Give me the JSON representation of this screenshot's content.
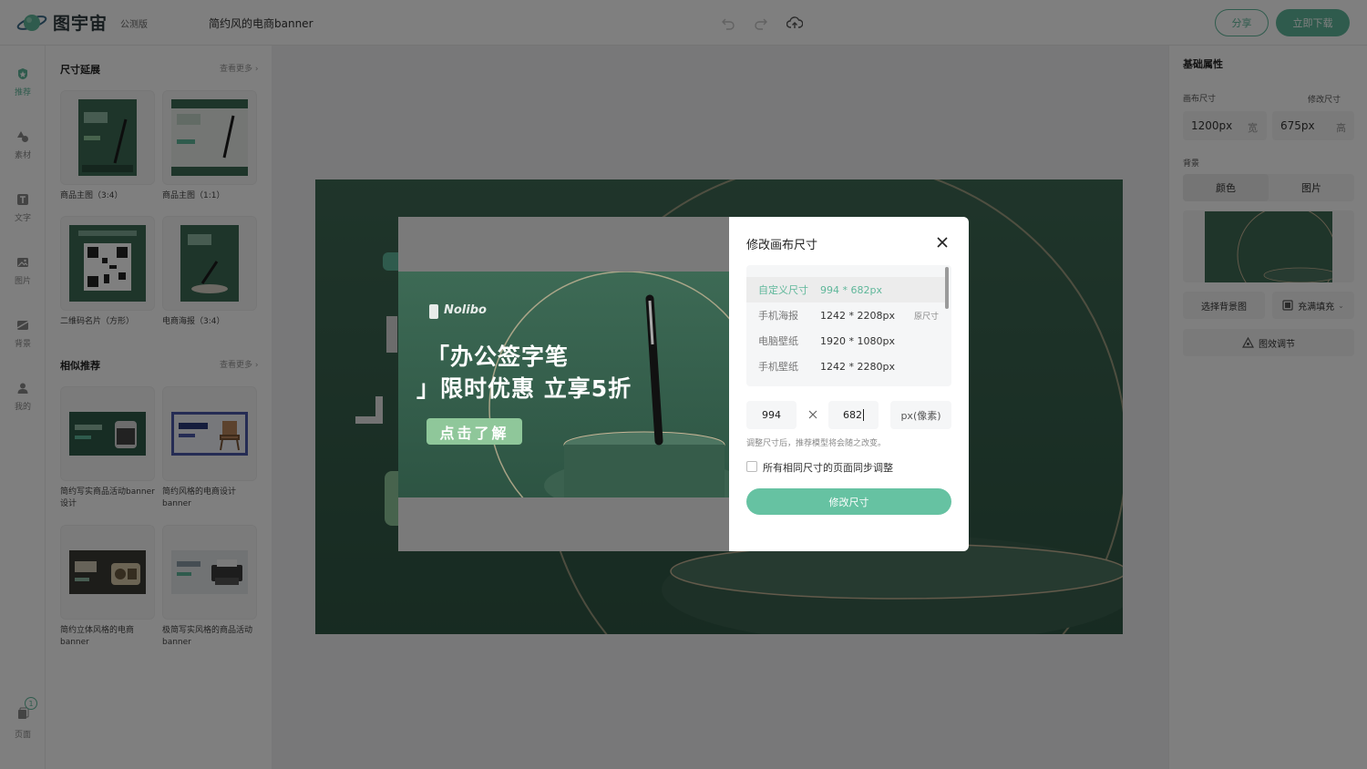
{
  "app": {
    "logo_text": "图宇宙",
    "beta_badge": "公测版",
    "doc_title": "简约风的电商banner"
  },
  "toolbar": {
    "undo_icon": "undo-icon",
    "redo_icon": "redo-icon",
    "cloud_icon": "cloud-save-icon",
    "share_label": "分享",
    "download_label": "立即下载"
  },
  "rail": {
    "items": [
      {
        "label": "推荐",
        "icon": "recommend-icon",
        "active": true
      },
      {
        "label": "素材",
        "icon": "shapes-icon"
      },
      {
        "label": "文字",
        "icon": "text-icon"
      },
      {
        "label": "图片",
        "icon": "image-icon"
      },
      {
        "label": "背景",
        "icon": "background-icon"
      },
      {
        "label": "我的",
        "icon": "user-icon"
      }
    ],
    "pages": {
      "label": "页面",
      "badge": "1"
    }
  },
  "panel": {
    "resize_section": {
      "title": "尺寸延展",
      "more": "查看更多"
    },
    "resize_cards": [
      {
        "caption": "商品主图（3:4）"
      },
      {
        "caption": "商品主图（1:1）"
      },
      {
        "caption": "二维码名片（方形）"
      },
      {
        "caption": "电商海报（3:4）"
      }
    ],
    "similar_section": {
      "title": "相似推荐",
      "more": "查看更多"
    },
    "similar_cards": [
      {
        "caption": "简约写实商品活动banner设计"
      },
      {
        "caption": "简约风格的电商设计banner"
      },
      {
        "caption": "简约立体风格的电商banner"
      },
      {
        "caption": "极简写实风格的商品活动banner"
      }
    ]
  },
  "props": {
    "title": "基础属性",
    "canvas_size_label": "画布尺寸",
    "modify_size_label": "修改尺寸",
    "width_value": "1200px",
    "width_unit": "宽",
    "height_value": "675px",
    "height_unit": "高",
    "background_label": "背景",
    "bg_tabs": [
      "颜色",
      "图片"
    ],
    "select_bg_label": "选择背景图",
    "fill_mode_label": "充满填充",
    "effect_label": "图效调节"
  },
  "preview": {
    "brand": "Nolibo",
    "headline_1": "「办公签字笔",
    "headline_2": "」限时优惠 立享5折",
    "cta": "点击了解"
  },
  "dialog": {
    "title": "修改画布尺寸",
    "sizes": [
      {
        "name": "自定义尺寸",
        "dims": "994 * 682px",
        "tag": "",
        "selected": true
      },
      {
        "name": "手机海报",
        "dims": "1242 * 2208px",
        "tag": "原尺寸"
      },
      {
        "name": "电脑壁纸",
        "dims": "1920 * 1080px",
        "tag": ""
      },
      {
        "name": "手机壁纸",
        "dims": "1242 * 2280px",
        "tag": ""
      }
    ],
    "width_input": "994",
    "height_input": "682",
    "unit": "px(像素)",
    "hint": "调整尺寸后，推荐模型将会随之改变。",
    "sync_label": "所有相同尺寸的页面同步调整",
    "submit_label": "修改尺寸"
  },
  "colors": {
    "accent": "#5fb79a",
    "canvas_green": "#3f6a55"
  }
}
